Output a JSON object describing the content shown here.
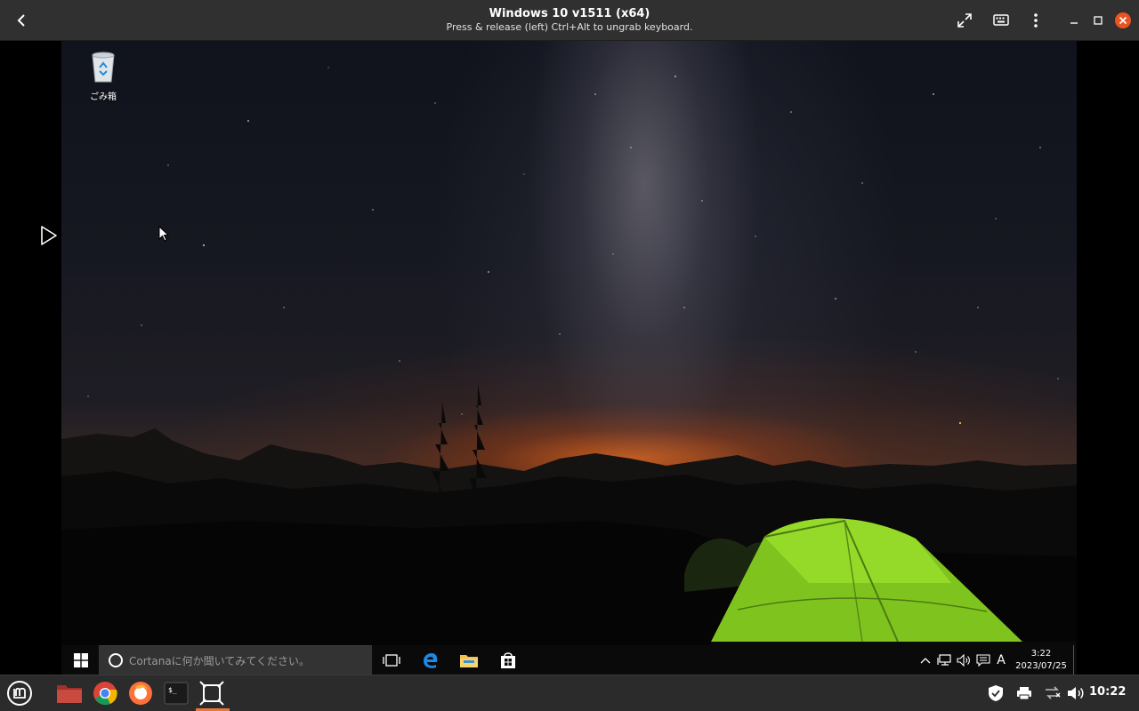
{
  "window": {
    "title": "Windows 10 v1511 (x64)",
    "subtitle": "Press & release (left) Ctrl+Alt to ungrab keyboard.",
    "icons": [
      "back-icon",
      "fullscreen-icon",
      "keyboard-icon",
      "menu-icon",
      "minimize-icon",
      "maximize-icon",
      "close-icon"
    ],
    "close_color": "#e95420"
  },
  "guest": {
    "desktop": {
      "recycle_bin_label": "ごみ箱"
    },
    "taskbar": {
      "search_placeholder": "Cortanaに何か聞いてみてください。",
      "pinned": [
        "task-view-icon",
        "edge-icon",
        "file-explorer-icon",
        "store-icon"
      ],
      "tray_icons": [
        "show-hidden-icons-icon",
        "network-icon",
        "volume-icon",
        "action-center-icon"
      ],
      "ime_indicator": "A",
      "clock_time": "3:22",
      "clock_date": "2023/07/25"
    }
  },
  "panel": {
    "launchers": [
      "mint-menu-icon",
      "files-icon",
      "chrome-icon",
      "firefox-icon",
      "terminal-icon",
      "boxes-icon"
    ],
    "tray": [
      "shield-icon",
      "printer-icon",
      "network-icon",
      "volume-icon"
    ],
    "time": "10:22",
    "accent": "#e8783a"
  }
}
